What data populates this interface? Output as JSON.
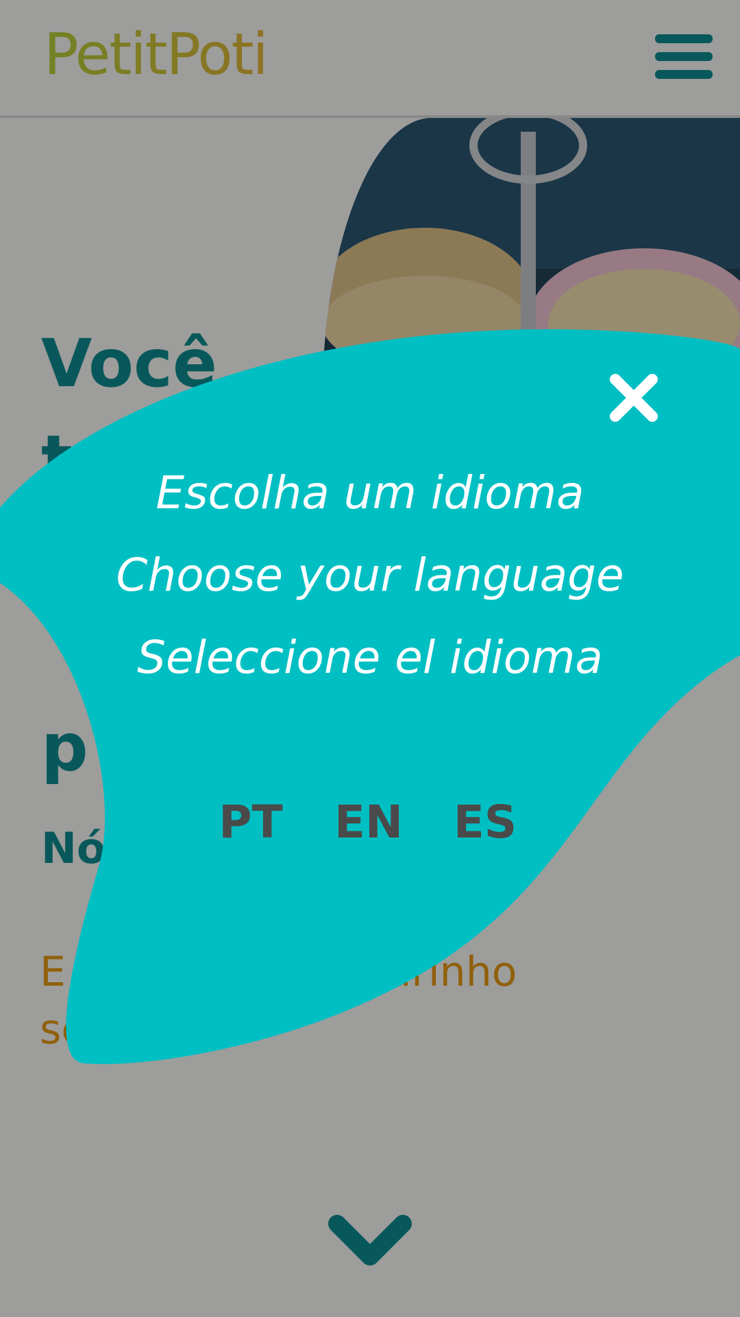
{
  "header": {
    "logo_text": "PetitPoti",
    "menu_icon": "hamburger-menu-icon"
  },
  "hero": {
    "headline_lines": [
      "Você",
      "te",
      "p"
    ],
    "subheading": "Nó",
    "body_text": "E            udo c            amor e carinho sempre."
  },
  "scroll": {
    "icon": "chevron-down-icon"
  },
  "modal": {
    "close_icon": "close-icon",
    "titles": [
      "Escolha um idioma",
      "Choose your language",
      "Seleccione el idioma"
    ],
    "languages": [
      "PT",
      "EN",
      "ES"
    ],
    "blob_color": "#00bfc3"
  },
  "colors": {
    "brand_teal": "#0e8f93",
    "accent_orange": "#e89b12",
    "modal_teal": "#00bfc3"
  }
}
